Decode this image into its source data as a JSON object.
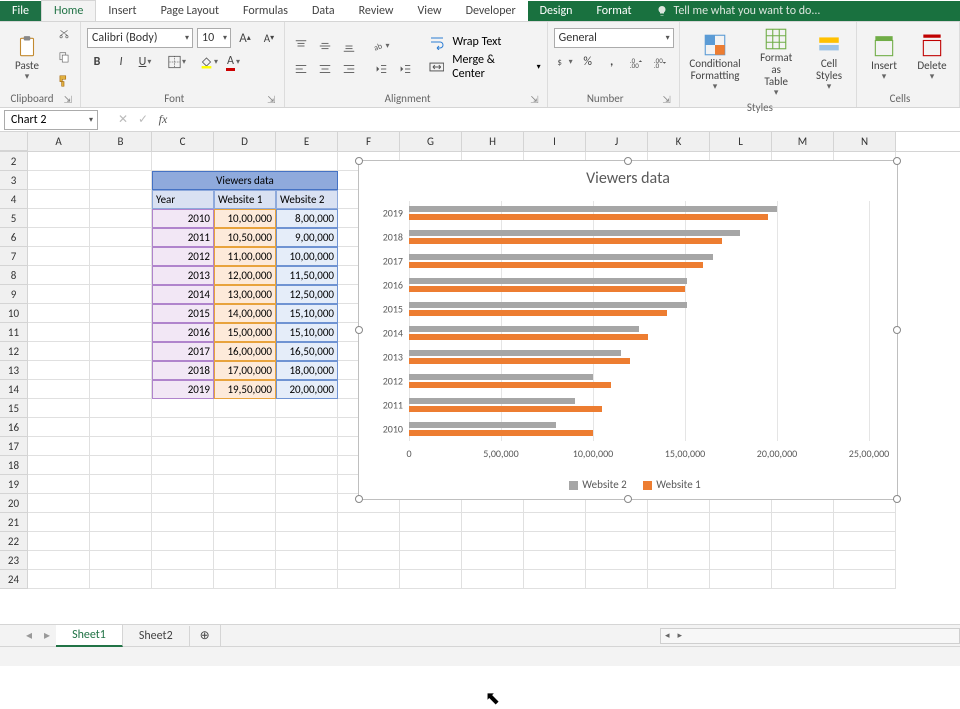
{
  "menubar": {
    "file": "File",
    "home": "Home",
    "insert": "Insert",
    "pageLayout": "Page Layout",
    "formulas": "Formulas",
    "data": "Data",
    "review": "Review",
    "view": "View",
    "developer": "Developer",
    "design": "Design",
    "format": "Format",
    "tell": "Tell me what you want to do..."
  },
  "ribbon": {
    "clipboard": {
      "label": "Clipboard",
      "paste": "Paste"
    },
    "font": {
      "label": "Font",
      "name": "Calibri (Body)",
      "size": "10"
    },
    "alignment": {
      "label": "Alignment",
      "wrap": "Wrap Text",
      "merge": "Merge & Center"
    },
    "number": {
      "label": "Number",
      "format": "General"
    },
    "styles": {
      "label": "Styles",
      "cond": "Conditional\nFormatting",
      "table": "Format as\nTable",
      "cell": "Cell\nStyles"
    },
    "cells": {
      "label": "Cells",
      "insert": "Insert",
      "delete": "Delete"
    }
  },
  "namebox": "Chart 2",
  "columns": [
    "A",
    "B",
    "C",
    "D",
    "E",
    "F",
    "G",
    "H",
    "I",
    "J",
    "K",
    "L",
    "M",
    "N"
  ],
  "rowStart": 2,
  "rowEnd": 24,
  "table": {
    "titleRow": 3,
    "title": "Viewers data",
    "hdrRow": 4,
    "headers": [
      "Year",
      "Website 1",
      "Website 2"
    ],
    "dataStartRow": 5,
    "rows": [
      {
        "year": "2010",
        "w1": "10,00,000",
        "w2": "8,00,000"
      },
      {
        "year": "2011",
        "w1": "10,50,000",
        "w2": "9,00,000"
      },
      {
        "year": "2012",
        "w1": "11,00,000",
        "w2": "10,00,000"
      },
      {
        "year": "2013",
        "w1": "12,00,000",
        "w2": "11,50,000"
      },
      {
        "year": "2014",
        "w1": "13,00,000",
        "w2": "12,50,000"
      },
      {
        "year": "2015",
        "w1": "14,00,000",
        "w2": "15,10,000"
      },
      {
        "year": "2016",
        "w1": "15,00,000",
        "w2": "15,10,000"
      },
      {
        "year": "2017",
        "w1": "16,00,000",
        "w2": "16,50,000"
      },
      {
        "year": "2018",
        "w1": "17,00,000",
        "w2": "18,00,000"
      },
      {
        "year": "2019",
        "w1": "19,50,000",
        "w2": "20,00,000"
      }
    ]
  },
  "sheets": {
    "active": "Sheet1",
    "tabs": [
      "Sheet1",
      "Sheet2"
    ]
  },
  "chart_data": {
    "type": "bar",
    "title": "Viewers data",
    "categories": [
      "2010",
      "2011",
      "2012",
      "2013",
      "2014",
      "2015",
      "2016",
      "2017",
      "2018",
      "2019"
    ],
    "series": [
      {
        "name": "Website 2",
        "color": "#a6a6a6",
        "values": [
          800000,
          900000,
          1000000,
          1150000,
          1250000,
          1510000,
          1510000,
          1650000,
          1800000,
          2000000
        ]
      },
      {
        "name": "Website 1",
        "color": "#ed7d31",
        "values": [
          1000000,
          1050000,
          1100000,
          1200000,
          1300000,
          1400000,
          1500000,
          1600000,
          1700000,
          1950000
        ]
      }
    ],
    "xticks": [
      0,
      500000,
      1000000,
      1500000,
      2000000,
      2500000
    ],
    "xtick_labels": [
      "0",
      "5,00,000",
      "10,00,000",
      "15,00,000",
      "20,00,000",
      "25,00,000"
    ],
    "xlim": [
      0,
      2500000
    ],
    "legend": [
      "Website 2",
      "Website 1"
    ]
  }
}
